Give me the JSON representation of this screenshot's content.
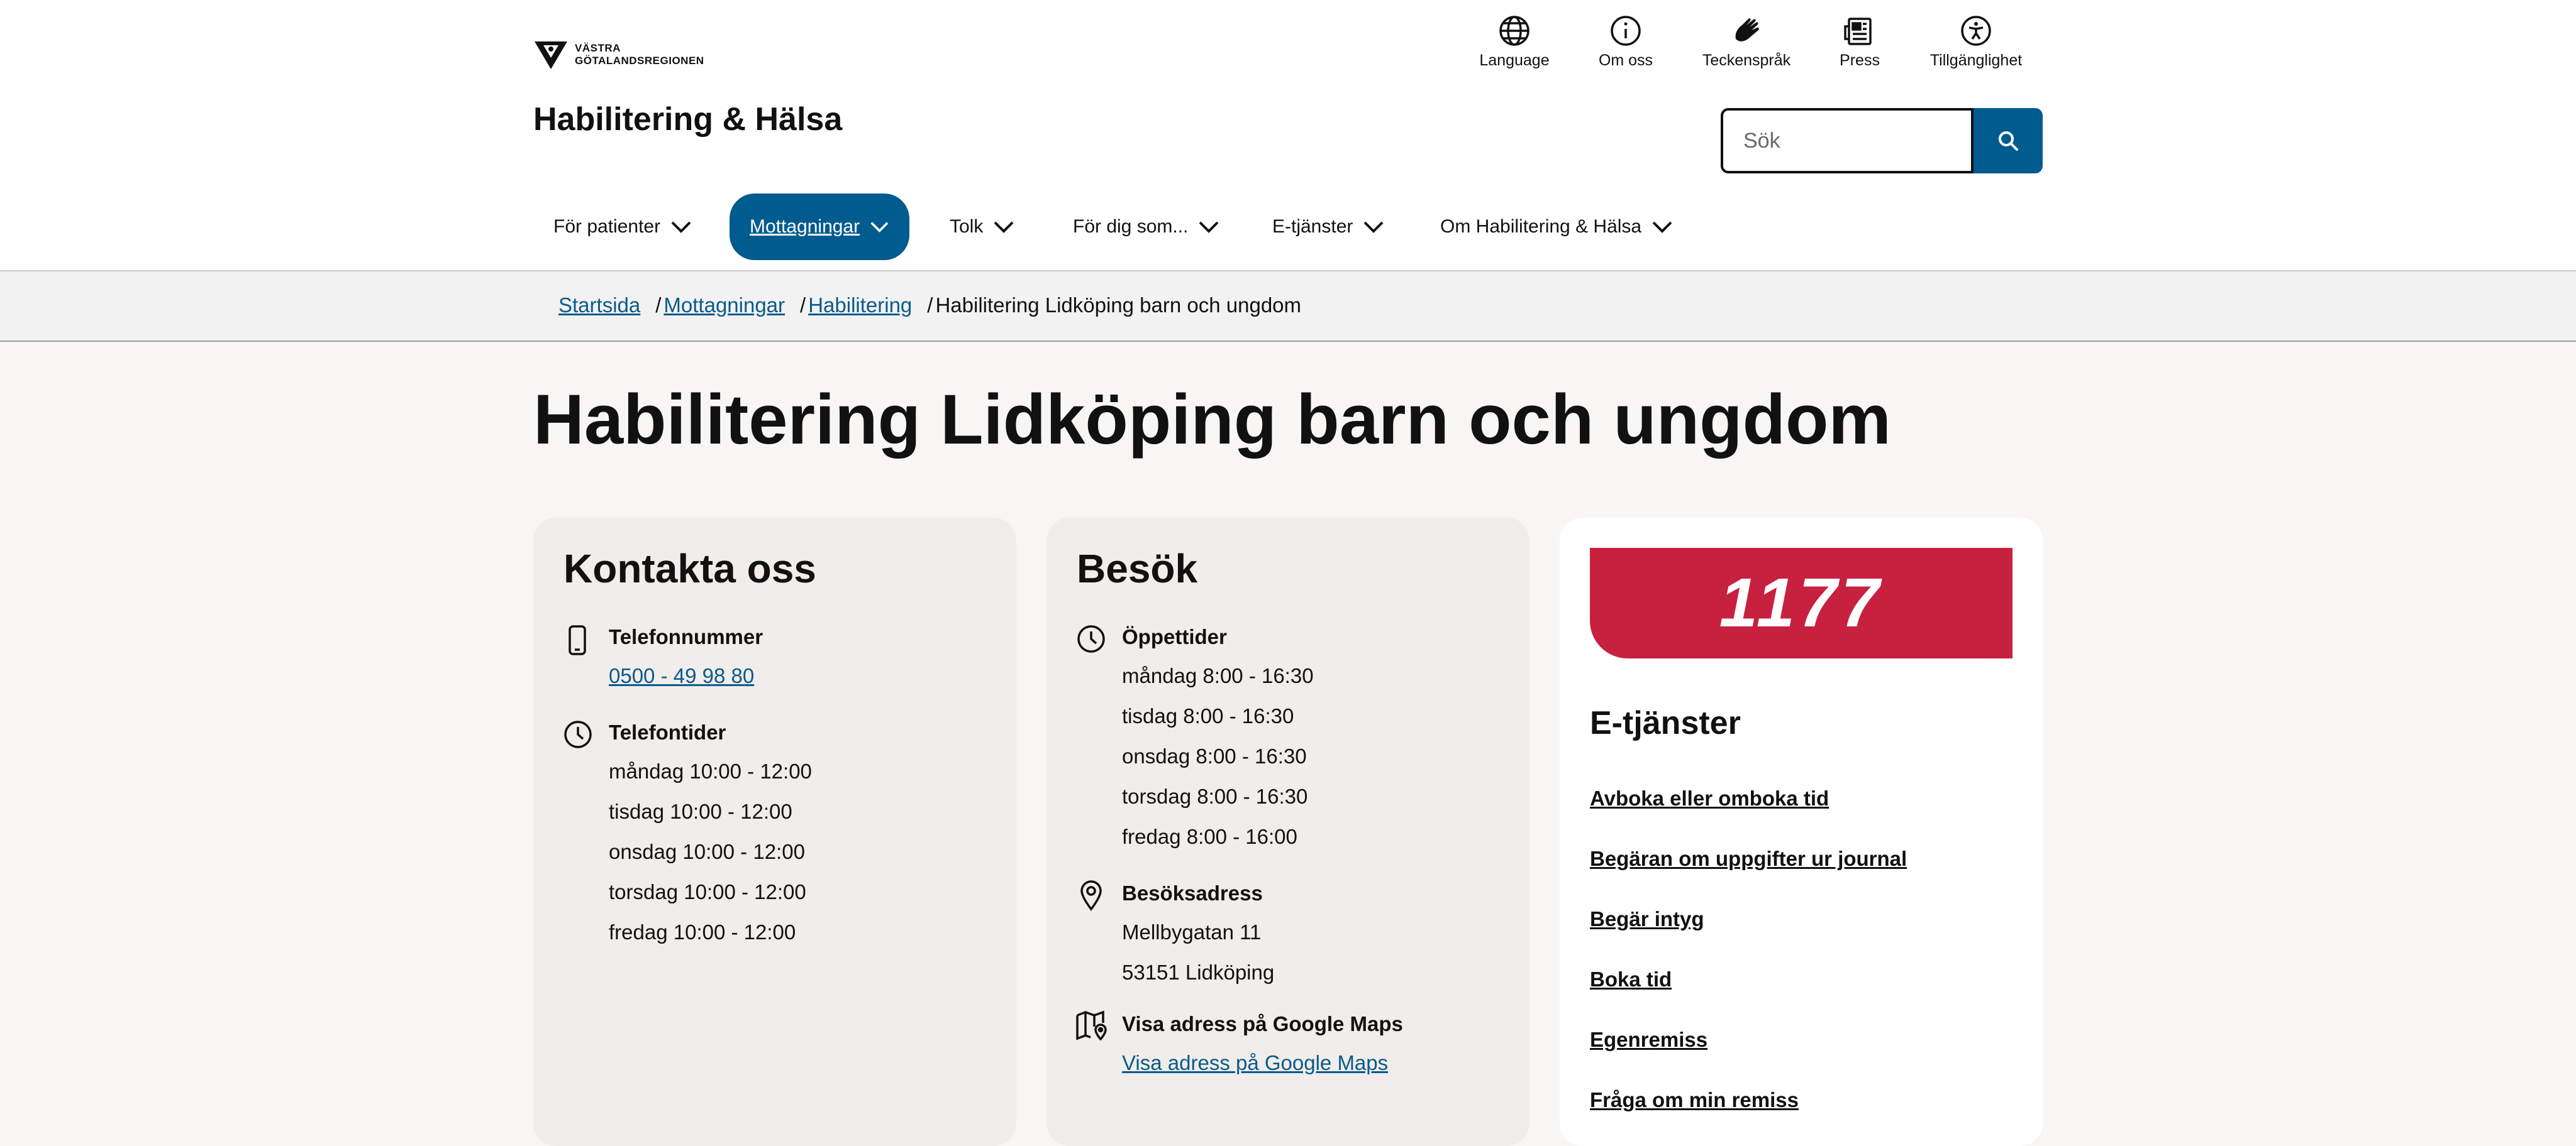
{
  "header": {
    "logo_line1": "VÄSTRA",
    "logo_line2": "GÖTALANDSREGIONEN",
    "site_title": "Habilitering & Hälsa",
    "utility": [
      {
        "label": "Language",
        "icon": "globe-icon"
      },
      {
        "label": "Om oss",
        "icon": "info-icon"
      },
      {
        "label": "Teckenspråk",
        "icon": "sign-language-icon"
      },
      {
        "label": "Press",
        "icon": "newspaper-icon"
      },
      {
        "label": "Tillgänglighet",
        "icon": "accessibility-icon"
      }
    ],
    "search_placeholder": "Sök"
  },
  "nav": {
    "items": [
      {
        "label": "För patienter",
        "active": false
      },
      {
        "label": "Mottagningar",
        "active": true
      },
      {
        "label": "Tolk",
        "active": false
      },
      {
        "label": "För dig som...",
        "active": false
      },
      {
        "label": "E-tjänster",
        "active": false
      },
      {
        "label": "Om Habilitering & Hälsa",
        "active": false
      }
    ]
  },
  "breadcrumb": {
    "items": [
      "Startsida",
      "Mottagningar",
      "Habilitering"
    ],
    "current": "Habilitering Lidköping barn och ungdom",
    "separator": "/"
  },
  "page_title": "Habilitering Lidköping barn och ungdom",
  "contact": {
    "title": "Kontakta oss",
    "phone_heading": "Telefonnummer",
    "phone_number": "0500 - 49 98 80",
    "hours_heading": "Telefontider",
    "hours": [
      "måndag 10:00 - 12:00",
      "tisdag 10:00 - 12:00",
      "onsdag 10:00 - 12:00",
      "torsdag 10:00 - 12:00",
      "fredag 10:00 - 12:00"
    ]
  },
  "visit": {
    "title": "Besök",
    "opening_heading": "Öppettider",
    "opening": [
      "måndag 8:00 - 16:30",
      "tisdag 8:00 - 16:30",
      "onsdag 8:00 - 16:30",
      "torsdag 8:00 - 16:30",
      "fredag 8:00 - 16:00"
    ],
    "address_heading": "Besöksadress",
    "address": [
      "Mellbygatan 11",
      "53151 Lidköping"
    ],
    "maps_heading": "Visa adress på Google Maps",
    "maps_link": "Visa adress på Google Maps"
  },
  "eservices": {
    "banner_text": "1177",
    "banner_color": "#c8203f",
    "title": "E-tjänster",
    "links": [
      "Avboka eller omboka tid",
      "Begäran om uppgifter ur journal",
      "Begär intyg",
      "Boka tid",
      "Egenremiss",
      "Fråga om min remiss"
    ]
  },
  "colors": {
    "accent": "#005b8f",
    "link": "#0a5a8a",
    "card_bg": "#f0edeb",
    "page_bg": "#f7f6f5"
  }
}
